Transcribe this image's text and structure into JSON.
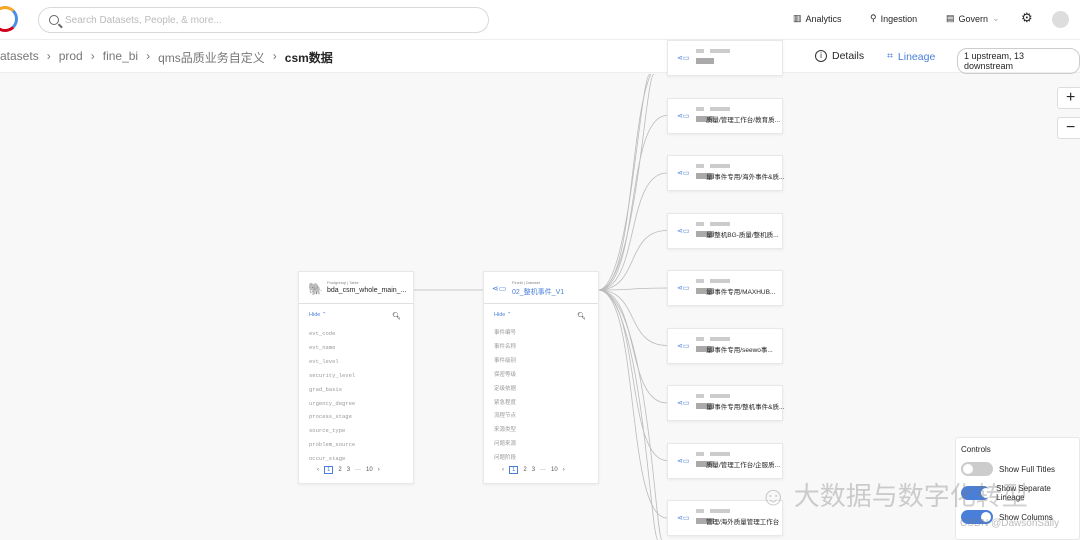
{
  "header": {
    "search_placeholder": "Search Datasets, People, & more...",
    "nav": [
      "Analytics",
      "Ingestion",
      "Govern"
    ]
  },
  "breadcrumb": [
    "atasets",
    "prod",
    "fine_bi",
    "qms品质业务自定义",
    "csm数据"
  ],
  "tabs": {
    "details": "Details",
    "lineage": "Lineage",
    "badge": "1 upstream, 13 downstream"
  },
  "source_node": {
    "platform": "Postgresql",
    "type": "Table",
    "name": "bda_csm_whole_main_...",
    "hide": "Hide",
    "columns": [
      "evt_code",
      "evt_name",
      "evt_level",
      "security_level",
      "grad_basis",
      "urgency_degree",
      "process_stage",
      "source_type",
      "problem_source",
      "occur_stage"
    ],
    "pages": [
      "1",
      "2",
      "3",
      "···",
      "10"
    ]
  },
  "mid_node": {
    "platform": "Finebi",
    "type": "Dataset",
    "name": "02_整机事件_V1",
    "hide": "Hide",
    "columns": [
      "事件编号",
      "事件名称",
      "事件级别",
      "保密等级",
      "定级依据",
      "紧急程度",
      "流程节点",
      "来源类型",
      "问题来源",
      "问题阶段"
    ],
    "pages": [
      "1",
      "2",
      "3",
      "···",
      "10"
    ]
  },
  "downstream": [
    "",
    "质量/管理工作台/教育质...",
    "量/事件专用/海外事件&质...",
    "量/整机BG-质量/整机质...",
    "量/事件专用/MAXHUB...",
    "量/事件专用/seewo事...",
    "量/事件专用/整机事件&质...",
    "质量/管理工作台/企服质...",
    "管理/海外质量管理工作台"
  ],
  "zoom": {
    "in": "+",
    "out": "−"
  },
  "controls": {
    "title": "Controls",
    "toggles": [
      {
        "label": "Show Full Titles",
        "on": false
      },
      {
        "label": "Show Separate Lineage",
        "on": true
      },
      {
        "label": "Show Columns",
        "on": true
      }
    ]
  },
  "watermark": {
    "text": "大数据与数字化转型",
    "credit": "CSDN @DawsonSally"
  }
}
